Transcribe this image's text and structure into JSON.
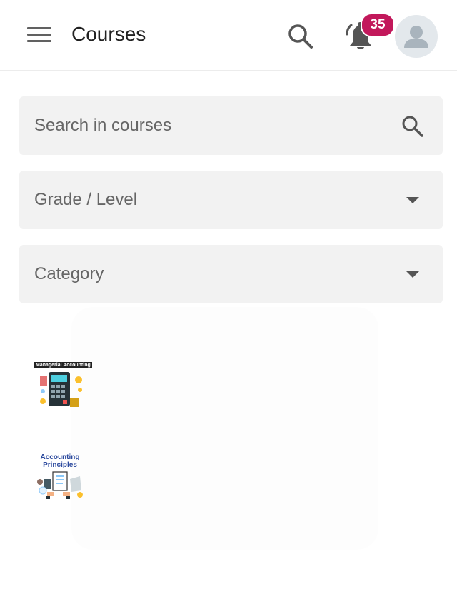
{
  "header": {
    "title": "Courses",
    "menu_icon": "hamburger-icon",
    "search_icon": "search-icon",
    "notification_icon": "bell-icon",
    "notification_count": "35",
    "avatar_icon": "user-avatar-icon"
  },
  "filters": {
    "search_placeholder": "Search in courses",
    "grade_label": "Grade / Level",
    "category_label": "Category"
  },
  "courses": [
    {
      "thumb_text": "Managerial Accounting"
    },
    {
      "thumb_text": "Accounting Principles"
    }
  ],
  "colors": {
    "badge": "#c2185b",
    "field_bg": "#f2f2f2",
    "icon": "#555555"
  }
}
